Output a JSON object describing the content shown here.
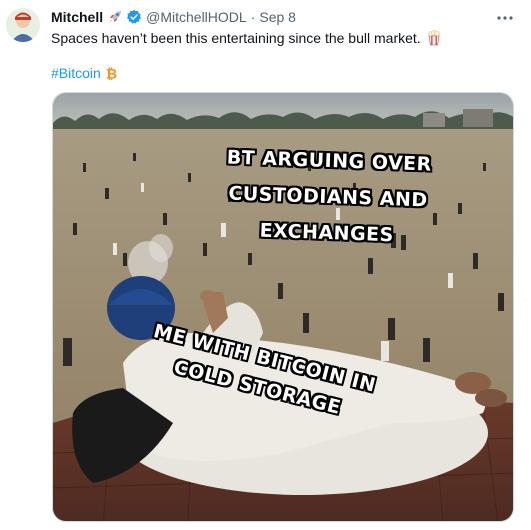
{
  "tweet": {
    "display_name": "Mitchell",
    "handle": "@MitchellHODL",
    "separator": "·",
    "date": "Sep 8",
    "text": "Spaces haven’t been this entertaining since the bull market.",
    "hashtag": "#Bitcoin",
    "icons": [
      "rocket-icon",
      "verified-badge-icon",
      "popcorn-icon",
      "bitcoin-icon",
      "more-icon"
    ],
    "colors": {
      "link": "#1d9bf0",
      "verified": "#1d9bf0",
      "bitcoin": "#f7931a",
      "secondary_text": "#536471"
    }
  },
  "meme": {
    "top_caption": [
      "BT ARGUING OVER",
      "CUSTODIANS AND",
      "EXCHANGES"
    ],
    "bottom_caption": [
      "ME WITH BITCOIN IN",
      "COLD STORAGE"
    ]
  }
}
